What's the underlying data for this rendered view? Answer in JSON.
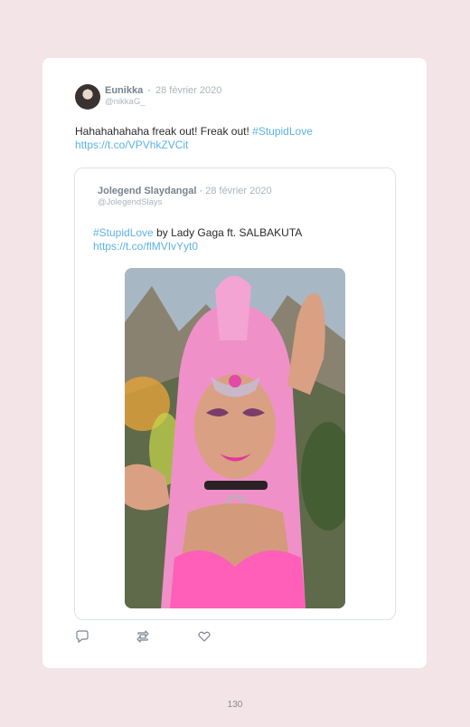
{
  "tweet": {
    "author_name": "Eunikka",
    "separator": "·",
    "date": "28 février 2020",
    "handle": "@nikkaG_",
    "text": "Hahahahahaha freak out! Freak out! ",
    "hashtag": "#StupidLove",
    "link": "https://t.co/VPVhkZVCit"
  },
  "quoted": {
    "author_name": "Jolegend Slaydangal",
    "separator": "·",
    "date": "28 février 2020",
    "handle": "@JolegendSlays",
    "hashtag": "#StupidLove",
    "text": " by Lady Gaga ft. SALBAKUTA",
    "link": "https://t.co/flMVIvYyt0"
  },
  "actions": {
    "reply_icon": "reply-icon",
    "retweet_icon": "retweet-icon",
    "like_icon": "like-icon"
  },
  "page_number": "130",
  "colors": {
    "background": "#f3e4e8",
    "link": "#5cb3e6",
    "card": "#ffffff"
  }
}
